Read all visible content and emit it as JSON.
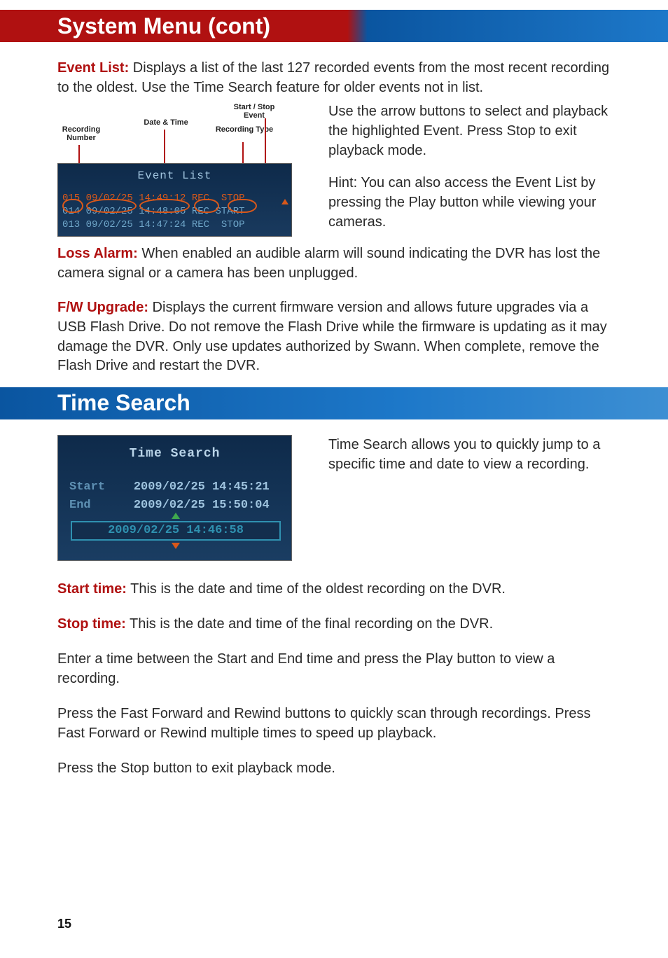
{
  "heading1": "System Menu (cont)",
  "event_list_intro": {
    "label": "Event List:",
    "text": "  Displays a list of the last 127 recorded events from the most recent recording to the oldest.  Use the Time Search feature for older events not in list."
  },
  "event_figure": {
    "labels": {
      "recording_number": "Recording Number",
      "date_time": "Date & Time",
      "start_stop": "Start / Stop Event",
      "recording_type": "Recording Type"
    },
    "screen_title": "Event List",
    "rows": [
      {
        "num": "015",
        "date": "09/02/25",
        "time": "14:49:12",
        "type": "REC",
        "event": "STOP",
        "selected": true
      },
      {
        "num": "014",
        "date": "09/02/25",
        "time": "14:48:05",
        "type": "REC",
        "event": "START",
        "selected": false
      },
      {
        "num": "013",
        "date": "09/02/25",
        "time": "14:47:24",
        "type": "REC",
        "event": "STOP",
        "selected": false
      }
    ]
  },
  "event_side": {
    "p1": "Use the arrow buttons to select and playback the highlighted Event.  Press Stop to exit playback mode.",
    "p2": "Hint:  You can also access the Event List by pressing the Play button while viewing your cameras."
  },
  "loss_alarm": {
    "label": "Loss Alarm:",
    "text": "  When enabled an audible alarm will sound indicating the DVR has lost the camera signal or a camera has been unplugged."
  },
  "fw_upgrade": {
    "label": "F/W Upgrade:",
    "text": "  Displays the current firmware version and allows future upgrades via a USB Flash Drive.  Do not remove the Flash Drive while the firmware is updating as it may damage the DVR.  Only use updates authorized by Swann. When complete, remove the Flash Drive and restart the DVR."
  },
  "heading2": "Time Search",
  "ts_figure": {
    "title": "Time Search",
    "start_label": "Start",
    "start_value": "2009/02/25 14:45:21",
    "end_label": "End",
    "end_value": "2009/02/25 15:50:04",
    "input_value": "2009/02/25 14:46:58"
  },
  "ts_side": "Time Search allows you to quickly jump to a specific time and date to view a recording.",
  "start_time": {
    "label": "Start time:",
    "text": "  This is the date and time of the oldest recording on the DVR."
  },
  "stop_time": {
    "label": "Stop time:",
    "text": "  This is the date and time of the final recording on the DVR."
  },
  "p_enter": "Enter a time between the Start and End time and press the Play button to view a recording.",
  "p_ff": "Press the Fast Forward and Rewind buttons to quickly scan through recordings. Press Fast Forward or Rewind multiple times to speed up playback.",
  "p_stop": "Press the Stop button to exit playback mode.",
  "page_number": "15"
}
